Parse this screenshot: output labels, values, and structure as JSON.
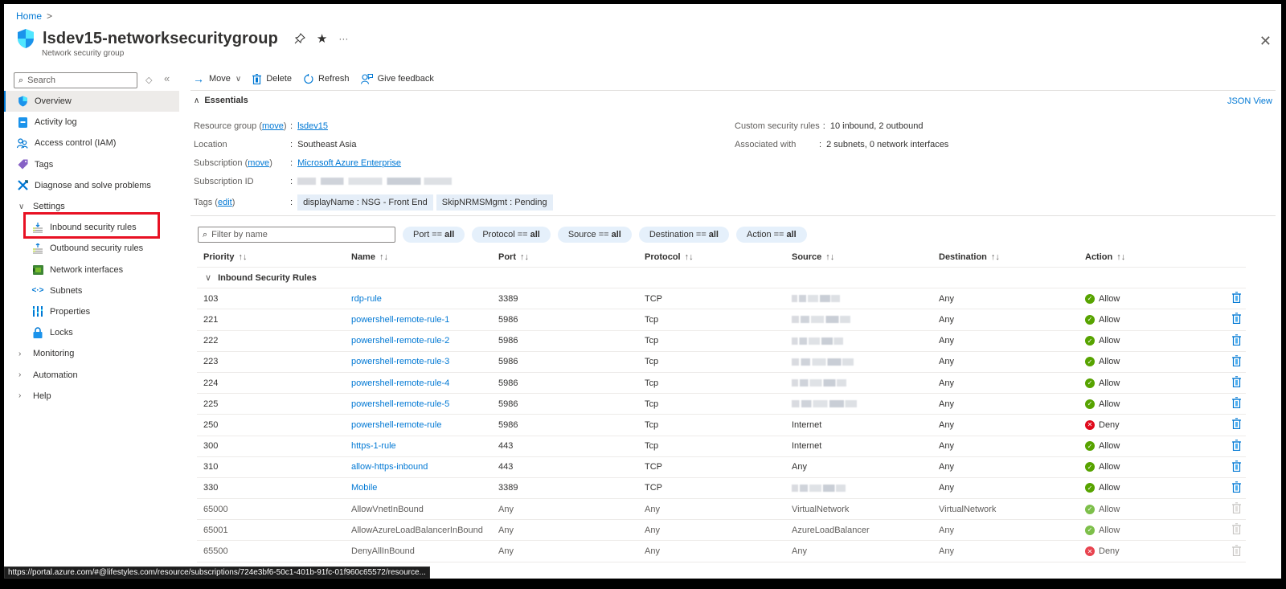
{
  "breadcrumb": {
    "home": "Home",
    "separator": ">"
  },
  "header": {
    "title": "lsdev15-networksecuritygroup",
    "subtitle": "Network security group",
    "more": "···",
    "close": "✕",
    "icons": {
      "resource": "shield-icon",
      "pin": "pin-icon",
      "favorite": "star-icon",
      "more": "ellipsis-icon",
      "close": "close-icon"
    }
  },
  "sidebar": {
    "search_placeholder": "Search",
    "expand_symbol": "◇",
    "collapse_symbol": "«",
    "items": [
      {
        "label": "Overview",
        "icon": "shield-icon",
        "active": true
      },
      {
        "label": "Activity log",
        "icon": "activity-log-icon"
      },
      {
        "label": "Access control (IAM)",
        "icon": "people-icon"
      },
      {
        "label": "Tags",
        "icon": "tag-icon"
      },
      {
        "label": "Diagnose and solve problems",
        "icon": "wrench-icon"
      },
      {
        "label": "Settings",
        "icon": "chevron-down-icon",
        "group": true,
        "expanded": true
      },
      {
        "label": "Inbound security rules",
        "icon": "inbound-rules-icon",
        "sub": true,
        "highlighted": true
      },
      {
        "label": "Outbound security rules",
        "icon": "outbound-rules-icon",
        "sub": true
      },
      {
        "label": "Network interfaces",
        "icon": "network-interface-icon",
        "sub": true
      },
      {
        "label": "Subnets",
        "icon": "subnet-icon",
        "sub": true
      },
      {
        "label": "Properties",
        "icon": "properties-icon",
        "sub": true
      },
      {
        "label": "Locks",
        "icon": "lock-icon",
        "sub": true
      },
      {
        "label": "Monitoring",
        "icon": "chevron-right-icon",
        "group": true
      },
      {
        "label": "Automation",
        "icon": "chevron-right-icon",
        "group": true
      },
      {
        "label": "Help",
        "icon": "chevron-right-icon",
        "group": true
      }
    ]
  },
  "toolbar": {
    "move": "Move",
    "delete": "Delete",
    "refresh": "Refresh",
    "feedback": "Give feedback"
  },
  "essentials": {
    "heading": "Essentials",
    "json_view": "JSON View",
    "resource_group_label": "Resource group",
    "resource_group_move": "move",
    "resource_group_value": "lsdev15",
    "location_label": "Location",
    "location_value": "Southeast Asia",
    "subscription_label": "Subscription",
    "subscription_move": "move",
    "subscription_value": "Microsoft Azure Enterprise",
    "subscription_id_label": "Subscription ID",
    "subscription_id_value": "[redacted]",
    "tags_label": "Tags",
    "tags_edit": "edit",
    "tags": [
      "displayName : NSG - Front End",
      "SkipNRMSMgmt : Pending"
    ],
    "custom_rules_label": "Custom security rules",
    "custom_rules_value": "10 inbound, 2 outbound",
    "associated_label": "Associated with",
    "associated_value": "2 subnets, 0 network interfaces",
    "separator": ":"
  },
  "filters": {
    "placeholder": "Filter by name",
    "pills": [
      {
        "key": "Port ==",
        "value": "all"
      },
      {
        "key": "Protocol ==",
        "value": "all"
      },
      {
        "key": "Source ==",
        "value": "all"
      },
      {
        "key": "Destination ==",
        "value": "all"
      },
      {
        "key": "Action ==",
        "value": "all"
      }
    ]
  },
  "table": {
    "columns": [
      "Priority",
      "Name",
      "Port",
      "Protocol",
      "Source",
      "Destination",
      "Action"
    ],
    "sort_symbol": "↑↓",
    "group_label": "Inbound Security Rules",
    "rows": [
      {
        "priority": "103",
        "name": "rdp-rule",
        "port": "3389",
        "protocol": "TCP",
        "source": "[redacted]",
        "source_redacted": true,
        "destination": "Any",
        "action": "Allow",
        "default": false
      },
      {
        "priority": "221",
        "name": "powershell-remote-rule-1",
        "port": "5986",
        "protocol": "Tcp",
        "source": "[redacted]",
        "source_redacted": true,
        "destination": "Any",
        "action": "Allow",
        "default": false
      },
      {
        "priority": "222",
        "name": "powershell-remote-rule-2",
        "port": "5986",
        "protocol": "Tcp",
        "source": "[redacted]",
        "source_redacted": true,
        "destination": "Any",
        "action": "Allow",
        "default": false
      },
      {
        "priority": "223",
        "name": "powershell-remote-rule-3",
        "port": "5986",
        "protocol": "Tcp",
        "source": "[redacted]",
        "source_redacted": true,
        "destination": "Any",
        "action": "Allow",
        "default": false
      },
      {
        "priority": "224",
        "name": "powershell-remote-rule-4",
        "port": "5986",
        "protocol": "Tcp",
        "source": "[redacted]",
        "source_redacted": true,
        "destination": "Any",
        "action": "Allow",
        "default": false
      },
      {
        "priority": "225",
        "name": "powershell-remote-rule-5",
        "port": "5986",
        "protocol": "Tcp",
        "source": "[redacted]",
        "source_redacted": true,
        "destination": "Any",
        "action": "Allow",
        "default": false
      },
      {
        "priority": "250",
        "name": "powershell-remote-rule",
        "port": "5986",
        "protocol": "Tcp",
        "source": "Internet",
        "destination": "Any",
        "action": "Deny",
        "default": false
      },
      {
        "priority": "300",
        "name": "https-1-rule",
        "port": "443",
        "protocol": "Tcp",
        "source": "Internet",
        "destination": "Any",
        "action": "Allow",
        "default": false
      },
      {
        "priority": "310",
        "name": "allow-https-inbound",
        "port": "443",
        "protocol": "TCP",
        "source": "Any",
        "destination": "Any",
        "action": "Allow",
        "default": false
      },
      {
        "priority": "330",
        "name": "Mobile",
        "port": "3389",
        "protocol": "TCP",
        "source": "[redacted]",
        "source_redacted": true,
        "destination": "Any",
        "action": "Allow",
        "default": false
      },
      {
        "priority": "65000",
        "name": "AllowVnetInBound",
        "port": "Any",
        "protocol": "Any",
        "source": "VirtualNetwork",
        "destination": "VirtualNetwork",
        "action": "Allow",
        "default": true
      },
      {
        "priority": "65001",
        "name": "AllowAzureLoadBalancerInBound",
        "port": "Any",
        "protocol": "Any",
        "source": "AzureLoadBalancer",
        "destination": "Any",
        "action": "Allow",
        "default": true
      },
      {
        "priority": "65500",
        "name": "DenyAllInBound",
        "port": "Any",
        "protocol": "Any",
        "source": "Any",
        "destination": "Any",
        "action": "Deny",
        "default": true
      }
    ]
  },
  "status_bar": {
    "url": "https://portal.azure.com/#@lifestyles.com/resource/subscriptions/724e3bf6-50c1-401b-91fc-01f960c65572/resource..."
  },
  "colors": {
    "accent": "#0078d4",
    "allow": "#57a300",
    "deny": "#e00b1c",
    "highlight": "#e81123",
    "pill_bg": "#e5f0fb"
  }
}
